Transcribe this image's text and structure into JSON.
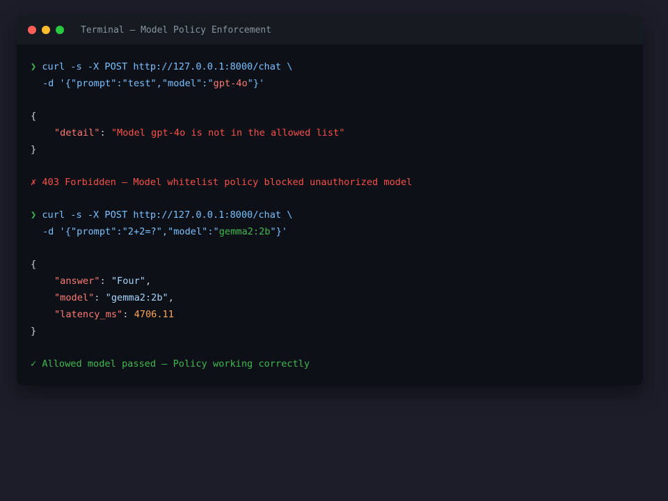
{
  "window": {
    "title": "Terminal — Model Policy Enforcement"
  },
  "block1": {
    "prompt_symbol": "❯",
    "command_line1": "curl -s -X POST http://127.0.0.1:8000/chat \\",
    "command_line2_prefix": "-d '{\"prompt\":\"test\",\"model\":\"",
    "command_line2_model": "gpt-4o",
    "command_line2_suffix": "\"}'",
    "open_brace": "{",
    "detail_key": "\"detail\"",
    "detail_value": "\"Model gpt-4o is not in the allowed list\"",
    "close_brace": "}",
    "status": "✗ 403 Forbidden — Model whitelist policy blocked unauthorized model"
  },
  "block2": {
    "prompt_symbol": "❯",
    "command_line1": "curl -s -X POST http://127.0.0.1:8000/chat \\",
    "command_line2_prefix": "-d '{\"prompt\":\"2+2=?\",\"model\":\"",
    "command_line2_model": "gemma2:2b",
    "command_line2_suffix": "\"}'",
    "open_brace": "{",
    "answer_key": "\"answer\"",
    "answer_value": "\"Four\"",
    "model_key": "\"model\"",
    "model_value": "\"gemma2:2b\"",
    "latency_key": "\"latency_ms\"",
    "latency_value": "4706.11",
    "close_brace": "}",
    "status": "✓ Allowed model passed — Policy working correctly"
  },
  "punct": {
    "colon": ": ",
    "comma": ","
  },
  "colors": {
    "background": "#1c1d29",
    "terminal_bg": "#0d1117",
    "titlebar_bg": "#161b22",
    "close": "#ff5f57",
    "minimize": "#febc2e",
    "maximize": "#28c840",
    "error": "#f85149",
    "success": "#3fb950",
    "command": "#79c0ff"
  }
}
